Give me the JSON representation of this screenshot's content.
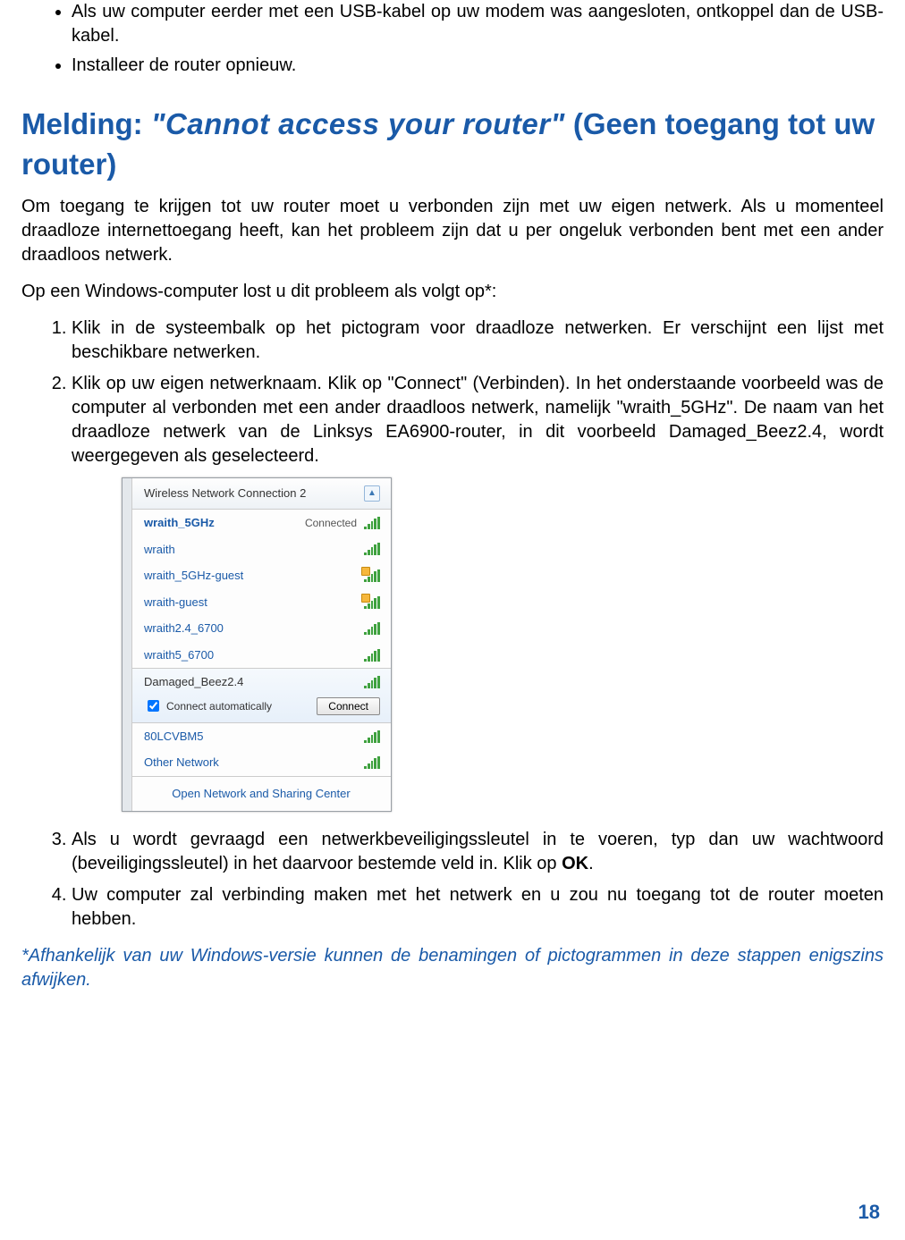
{
  "bullets": [
    "Als uw computer eerder met een USB-kabel op uw modem was aangesloten, ontkoppel dan de USB-kabel.",
    "Installeer de router opnieuw."
  ],
  "heading": {
    "lead": "Melding: ",
    "quote": "\"Cannot access your router\"",
    "tail": " (Geen toegang tot uw router)"
  },
  "para1": "Om toegang te krijgen tot uw router moet u verbonden zijn met uw eigen netwerk. Als u momenteel draadloze internettoegang heeft, kan het probleem zijn dat u per ongeluk verbonden bent met een ander draadloos netwerk.",
  "para2": "Op een Windows-computer lost u dit probleem als volgt op*:",
  "steps": {
    "s1": "Klik in de systeembalk op het pictogram voor draadloze netwerken. Er verschijnt een lijst met beschikbare netwerken.",
    "s2": "Klik op uw eigen netwerknaam. Klik op \"Connect\" (Verbinden). In het onderstaande voorbeeld was de computer al verbonden met een ander draadloos netwerk, namelijk \"wraith_5GHz\". De naam van het draadloze netwerk van de Linksys EA6900-router, in dit voorbeeld Damaged_Beez2.4, wordt weergegeven als geselecteerd.",
    "s3_a": "Als u wordt gevraagd een netwerkbeveiligingssleutel in te voeren, typ dan uw wachtwoord (beveiligingssleutel) in het daarvoor bestemde veld in. Klik op ",
    "s3_b": "OK",
    "s3_c": ".",
    "s4": "Uw computer zal verbinding maken met het netwerk en u zou nu toegang tot de router moeten hebben."
  },
  "footnote": "*Afhankelijk van uw Windows-versie kunnen de benamingen of pictogrammen in deze stappen enigszins afwijken.",
  "page_number": "18",
  "wifi": {
    "header": "Wireless Network Connection 2",
    "connected_label": "Connected",
    "connect_btn": "Connect",
    "auto_label": "Connect automatically",
    "footer": "Open Network and Sharing Center",
    "networks": {
      "n0": "wraith_5GHz",
      "n1": "wraith",
      "n2": "wraith_5GHz-guest",
      "n3": "wraith-guest",
      "n4": "wraith2.4_6700",
      "n5": "wraith5_6700",
      "selected": "Damaged_Beez2.4",
      "n6": "80LCVBM5",
      "n7": "Other Network"
    }
  }
}
